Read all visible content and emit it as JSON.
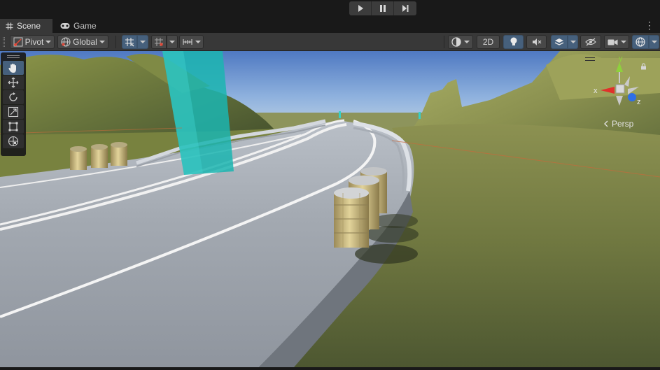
{
  "playbar": {
    "play_icon": "play-icon",
    "pause_icon": "pause-icon",
    "step_icon": "step-icon"
  },
  "tabs": [
    {
      "label": "Scene",
      "icon": "grid-icon"
    },
    {
      "label": "Game",
      "icon": "gamepad-icon"
    }
  ],
  "toolbar": {
    "pivot_label": "Pivot",
    "global_label": "Global",
    "mode_2d_label": "2D"
  },
  "tools": [
    "hand-tool",
    "move-tool",
    "rotate-tool",
    "scale-tool",
    "rect-tool",
    "transform-tool"
  ],
  "selected_tool": "hand-tool",
  "gizmo": {
    "x_label": "x",
    "y_label": "y",
    "z_label": "z",
    "projection_label": "Persp"
  },
  "colors": {
    "accent": "#46607c",
    "x_axis": "#e0312b",
    "y_axis": "#8ed13c",
    "z_axis": "#2f6fe6"
  }
}
